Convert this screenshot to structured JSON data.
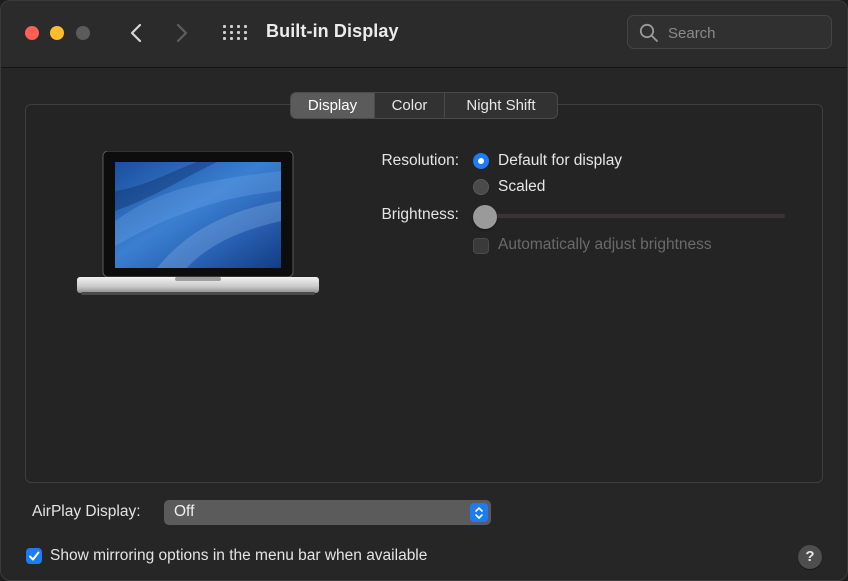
{
  "window": {
    "title": "Built-in Display"
  },
  "toolbar": {
    "search_placeholder": "Search"
  },
  "tabs": [
    {
      "label": "Display",
      "active": true
    },
    {
      "label": "Color",
      "active": false
    },
    {
      "label": "Night Shift",
      "active": false
    }
  ],
  "display": {
    "resolution_label": "Resolution:",
    "resolution_options": [
      {
        "label": "Default for display",
        "selected": true
      },
      {
        "label": "Scaled",
        "selected": false
      }
    ],
    "brightness_label": "Brightness:",
    "brightness_level": 0,
    "auto_brightness_label": "Automatically adjust brightness",
    "auto_brightness_checked": false,
    "auto_brightness_enabled": false
  },
  "airplay": {
    "label": "AirPlay Display:",
    "value": "Off"
  },
  "mirroring": {
    "label": "Show mirroring options in the menu bar when available",
    "checked": true
  },
  "help": {
    "label": "?"
  },
  "colors": {
    "accent": "#1c7cf5",
    "close": "#fe5f57",
    "minimize": "#febc2e",
    "zoom_disabled": "#5b5b5b"
  }
}
